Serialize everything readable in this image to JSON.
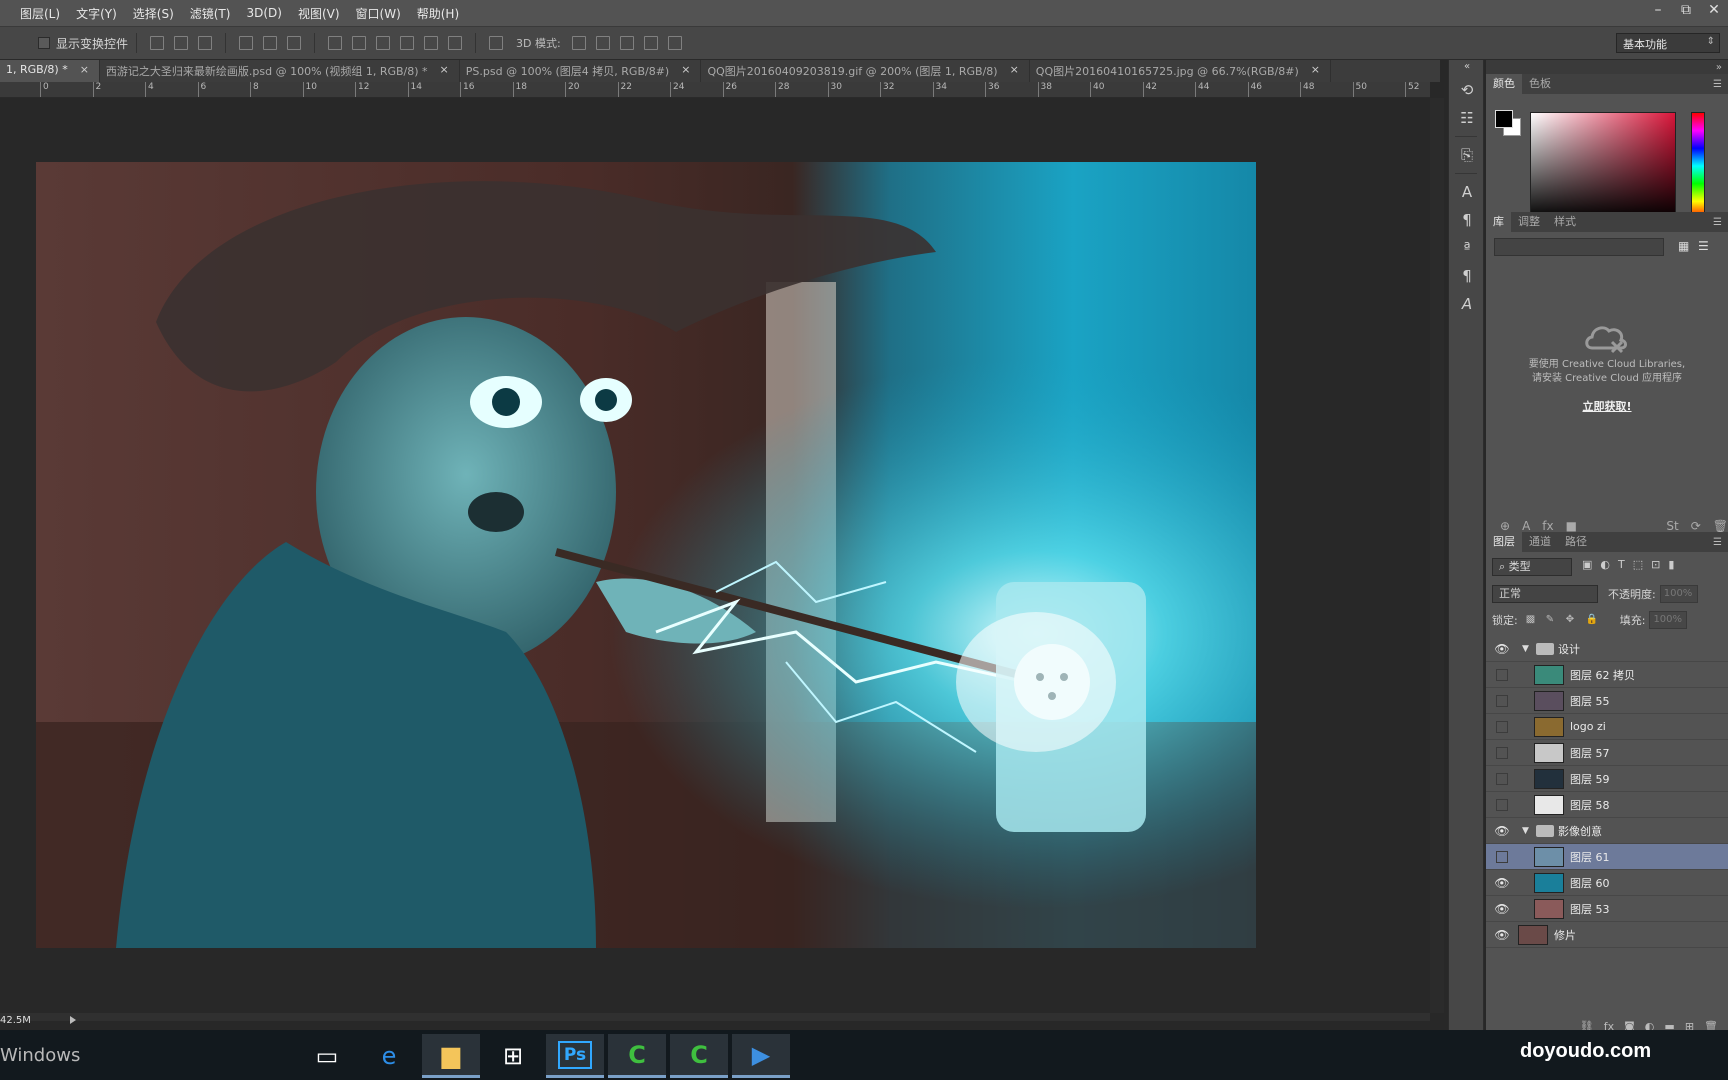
{
  "menu": {
    "items": [
      "图层(L)",
      "文字(Y)",
      "选择(S)",
      "滤镜(T)",
      "3D(D)",
      "视图(V)",
      "窗口(W)",
      "帮助(H)"
    ]
  },
  "window_controls": {
    "minimize": "–",
    "restore": "⧉",
    "close": "✕"
  },
  "options_bar": {
    "show_transform_label": "显示变换控件",
    "mode_label": "3D 模式:",
    "workspace": "基本功能"
  },
  "tabs": [
    {
      "label": "1, RGB/8) *",
      "close": "×"
    },
    {
      "label": "西游记之大圣归来最新绘画版.psd @ 100% (视频组 1, RGB/8) *",
      "close": "×"
    },
    {
      "label": "PS.psd @ 100% (图层4 拷贝, RGB/8#)",
      "close": "×"
    },
    {
      "label": "QQ图片20160409203819.gif @ 200% (图层 1, RGB/8)",
      "close": "×"
    },
    {
      "label": "QQ图片20160410165725.jpg @ 66.7%(RGB/8#)",
      "close": "×"
    }
  ],
  "ruler": {
    "ticks": [
      "0",
      "2",
      "4",
      "6",
      "8",
      "10",
      "12",
      "14",
      "16",
      "18",
      "20",
      "22",
      "24",
      "26",
      "28",
      "30",
      "32",
      "34",
      "36",
      "38",
      "40",
      "42",
      "44",
      "46",
      "48",
      "50",
      "52"
    ]
  },
  "status": {
    "doc_size": "42.5M"
  },
  "color_panel": {
    "tabs": [
      "颜色",
      "色板"
    ],
    "fg": "#000000",
    "bg": "#ffffff",
    "field_hue": "#d9163a"
  },
  "library_panel": {
    "tabs": [
      "库",
      "调整",
      "样式"
    ],
    "message_line1": "要使用 Creative Cloud Libraries,",
    "message_line2": "请安装 Creative Cloud 应用程序",
    "link": "立即获取!"
  },
  "layers_panel": {
    "tabs": [
      "图层",
      "通道",
      "路径"
    ],
    "filter": "类型",
    "blend_mode": "正常",
    "opacity_label": "不透明度:",
    "opacity_value": "100%",
    "lock_label": "锁定:",
    "fill_label": "填充:",
    "fill_value": "100%",
    "layers": [
      {
        "name": "设计",
        "type": "group",
        "visible": true,
        "selected": false
      },
      {
        "name": "图层 62 拷贝",
        "type": "layer",
        "visible": false,
        "selected": false,
        "thumb": "#3a8a7a"
      },
      {
        "name": "图层 55",
        "type": "layer",
        "visible": false,
        "selected": false,
        "thumb": "#5a4e5e"
      },
      {
        "name": "logo zi",
        "type": "layer",
        "visible": false,
        "selected": false,
        "thumb": "#8a6a30"
      },
      {
        "name": "图层 57",
        "type": "layer",
        "visible": false,
        "selected": false,
        "thumb": "#c8c8c8"
      },
      {
        "name": "图层 59",
        "type": "layer",
        "visible": false,
        "selected": false,
        "thumb": "#22303c"
      },
      {
        "name": "图层 58",
        "type": "layer",
        "visible": false,
        "selected": false,
        "thumb": "#e8e8e8"
      },
      {
        "name": "影像创意",
        "type": "group",
        "visible": true,
        "selected": false
      },
      {
        "name": "图层 61",
        "type": "layer",
        "visible": false,
        "selected": true,
        "thumb": "#6d8fa8"
      },
      {
        "name": "图层 60",
        "type": "layer",
        "visible": true,
        "selected": false,
        "thumb": "#1a7f9a"
      },
      {
        "name": "图层 53",
        "type": "layer",
        "visible": true,
        "selected": false,
        "thumb": "#8a5a5a"
      },
      {
        "name": "修片",
        "type": "root",
        "visible": true,
        "selected": false,
        "thumb": "#6a4a48"
      }
    ]
  },
  "taskbar": {
    "windows_text": "Windows",
    "watermark": "doyoudo.com"
  }
}
